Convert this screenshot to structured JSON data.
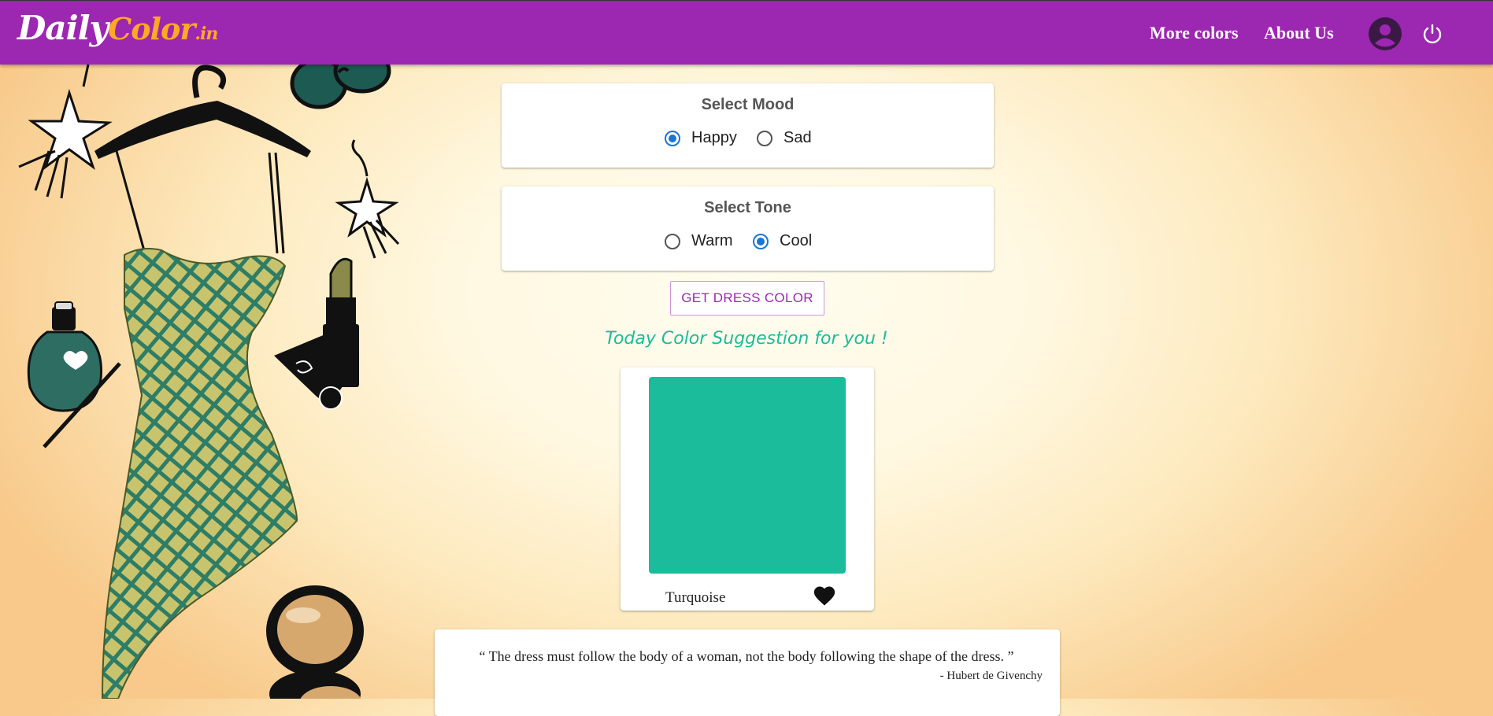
{
  "brand": {
    "logo_daily": "Daily",
    "logo_color": "Color",
    "logo_in": ".in"
  },
  "nav": {
    "more_colors": "More colors",
    "about_us": "About Us"
  },
  "mood": {
    "title": "Select Mood",
    "options": [
      {
        "label": "Happy",
        "selected": true
      },
      {
        "label": "Sad",
        "selected": false
      }
    ]
  },
  "tone": {
    "title": "Select Tone",
    "options": [
      {
        "label": "Warm",
        "selected": false
      },
      {
        "label": "Cool",
        "selected": true
      }
    ]
  },
  "actions": {
    "get_dress_color": "GET DRESS COLOR"
  },
  "suggestion": {
    "heading": "Today Color Suggestion for you !",
    "color_name": "Turquoise",
    "color_hex": "#1abc9c"
  },
  "quote": {
    "text": "“ The dress must follow the body of a woman, not the body following the shape of the dress. ”",
    "author": "- Hubert de Givenchy"
  },
  "colors": {
    "header": "#9c27b0",
    "accent_orange": "#ffa726",
    "radio_blue": "#1976d2",
    "dress_green": "#2e7d66",
    "dress_yellow": "#c8c46e"
  }
}
